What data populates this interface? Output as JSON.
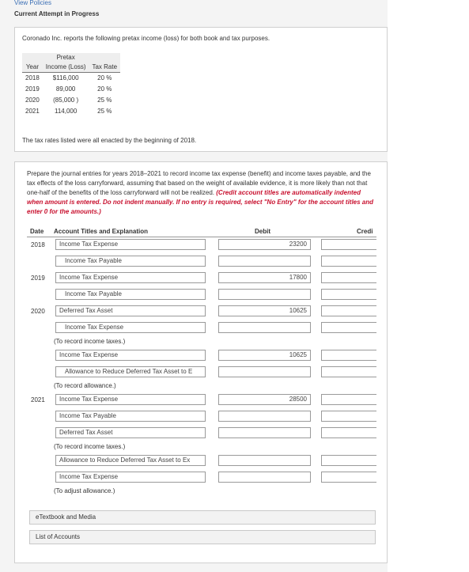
{
  "header": {
    "view_policies": "View Policies",
    "attempt": "Current Attempt in Progress"
  },
  "problem": {
    "intro": "Coronado Inc. reports the following pretax income (loss) for both book and tax purposes.",
    "table": {
      "col_year": "Year",
      "col_income_top": "Pretax",
      "col_income": "Income (Loss)",
      "col_rate": "Tax Rate",
      "rows": [
        {
          "year": "2018",
          "income": "$116,000",
          "rate": "20  %"
        },
        {
          "year": "2019",
          "income": "89,000",
          "rate": "20  %"
        },
        {
          "year": "2020",
          "income": "(85,000  )",
          "rate": "25  %"
        },
        {
          "year": "2021",
          "income": "114,000",
          "rate": "25  %"
        }
      ]
    },
    "note": "The tax rates listed were all enacted by the beginning of 2018."
  },
  "instructions": {
    "text": "Prepare the journal entries for years 2018–2021 to record income tax expense (benefit) and income taxes payable, and the tax effects of the loss carryforward, assuming that based on the weight of available evidence, it is more likely than not that one-half of the benefits of the loss carryforward will not be realized.",
    "red": "(Credit account titles are automatically indented when amount is entered. Do not indent manually. If no entry is required, select \"No Entry\" for the account titles and enter 0 for the amounts.)"
  },
  "journal": {
    "headers": {
      "date": "Date",
      "account": "Account Titles and Explanation",
      "debit": "Debit",
      "credit": "Credi"
    },
    "dates": [
      "2018",
      "2019",
      "2020",
      "2021"
    ],
    "lines": [
      {
        "account": "Income Tax Expense",
        "debit": "23200",
        "credit": ""
      },
      {
        "account": "Income Tax Payable",
        "debit": "",
        "credit": ""
      },
      {
        "account": "Income Tax Expense",
        "debit": "17800",
        "credit": ""
      },
      {
        "account": "Income Tax Payable",
        "debit": "",
        "credit": ""
      },
      {
        "account": "Deferred Tax Asset",
        "debit": "10625",
        "credit": ""
      },
      {
        "account": "Income Tax Expense",
        "debit": "",
        "credit": ""
      },
      {
        "account": "Income Tax Expense",
        "debit": "10625",
        "credit": ""
      },
      {
        "account": "Allowance to Reduce Deferred Tax Asset to E",
        "debit": "",
        "credit": ""
      },
      {
        "account": "Income Tax Expense",
        "debit": "28500",
        "credit": ""
      },
      {
        "account": "Income Tax Payable",
        "debit": "",
        "credit": ""
      },
      {
        "account": "Deferred Tax Asset",
        "debit": "",
        "credit": ""
      },
      {
        "account": "Allowance to Reduce Deferred Tax Asset to Ex",
        "debit": "",
        "credit": ""
      },
      {
        "account": "Income Tax Expense",
        "debit": "",
        "credit": ""
      }
    ],
    "memos": [
      "(To record income taxes.)",
      "(To record allowance.)",
      "(To record income taxes.)",
      "(To adjust allowance.)"
    ]
  },
  "footer": {
    "etextbook": "eTextbook and Media",
    "list_accounts": "List of Accounts"
  }
}
